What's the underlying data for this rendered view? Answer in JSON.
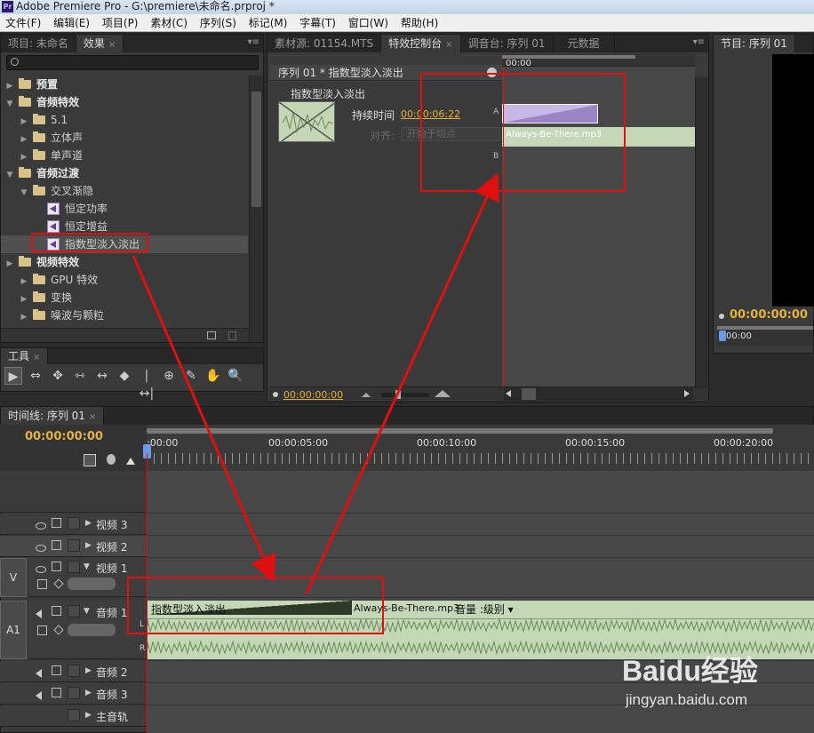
{
  "window": {
    "title": "Adobe Premiere Pro - G:\\premiere\\未命名.prproj *",
    "app_icon": "Pr"
  },
  "menu": [
    "文件(F)",
    "编辑(E)",
    "项目(P)",
    "素材(C)",
    "序列(S)",
    "标记(M)",
    "字幕(T)",
    "窗口(W)",
    "帮助(H)"
  ],
  "effects_panel": {
    "tabs": [
      "项目: 未命名",
      "效果"
    ],
    "close_glyph": "×",
    "menu_glyph": "▾≡",
    "tree": [
      {
        "label": "预置",
        "type": "folder",
        "bold": true,
        "expanded": false,
        "indent": 0
      },
      {
        "label": "音频特效",
        "type": "folder",
        "bold": true,
        "expanded": true,
        "indent": 0
      },
      {
        "label": "5.1",
        "type": "folder",
        "expanded": false,
        "indent": 1
      },
      {
        "label": "立体声",
        "type": "folder",
        "expanded": false,
        "indent": 1
      },
      {
        "label": "单声道",
        "type": "folder",
        "expanded": false,
        "indent": 1
      },
      {
        "label": "音频过渡",
        "type": "folder",
        "bold": true,
        "expanded": true,
        "indent": 0
      },
      {
        "label": "交叉渐隐",
        "type": "folder",
        "expanded": true,
        "indent": 1
      },
      {
        "label": "恒定功率",
        "type": "fx",
        "indent": 2
      },
      {
        "label": "恒定增益",
        "type": "fx",
        "indent": 2
      },
      {
        "label": "指数型淡入淡出",
        "type": "fx",
        "indent": 2,
        "selected": true
      },
      {
        "label": "视频特效",
        "type": "folder",
        "bold": true,
        "expanded": false,
        "indent": 0
      },
      {
        "label": "GPU 特效",
        "type": "folder",
        "expanded": false,
        "indent": 1
      },
      {
        "label": "变换",
        "type": "folder",
        "expanded": false,
        "indent": 1
      },
      {
        "label": "噪波与颗粒",
        "type": "folder",
        "expanded": false,
        "indent": 1
      }
    ]
  },
  "tools_panel": {
    "title": "工具",
    "tools": [
      "▶",
      "⇔",
      "✥",
      "⇿",
      "↔",
      "◆",
      "|↔|",
      "⊕",
      "✎",
      "✋",
      "🔍"
    ]
  },
  "effect_controls": {
    "tabs": [
      "素材源: 01154.MTS",
      "特效控制台",
      "调音台: 序列 01",
      "元数据"
    ],
    "header": "序列 01 * 指数型淡入淡出",
    "effect_name": "指数型淡入淡出",
    "duration_label": "持续时间",
    "duration_value": "00:00:06:22",
    "align_label": "对齐:",
    "align_value": "开始于切点",
    "timeline_start": "00:00",
    "track_a_label": "A",
    "track_b_label": "B",
    "clip_name": "Always-Be-There.mp3",
    "footer_time": "00:00:00:00"
  },
  "program_monitor": {
    "tab": "节目: 序列 01",
    "time": "00:00:00:00",
    "ruler_start": "00:00"
  },
  "timeline": {
    "tab": "时间线: 序列 01",
    "current_time": "00:00:00:00",
    "ruler_labels": [
      ":00:00",
      "00:00:05:00",
      "00:00:10:00",
      "00:00:15:00",
      "00:00:20:00"
    ],
    "section_v": "V",
    "section_a1": "A1",
    "tracks": {
      "video3": "视频 3",
      "video2": "视频 2",
      "video1": "视频 1",
      "audio1": "音频 1",
      "audio2": "音频 2",
      "audio3": "音频 3",
      "master": "主音轨"
    },
    "audio_clip": {
      "transition_label": "指数型淡入淡出",
      "clip_name": "Always-Be-There.mp3",
      "volume_label": "音量 :级别 ▾",
      "channel_l": "L",
      "channel_r": "R"
    }
  },
  "watermark": {
    "brand": "Baidu经验",
    "url": "jingyan.baidu.com"
  },
  "colors": {
    "accent_time": "#e3b23c",
    "annotation_red": "#e01010",
    "clip_green": "#c4d8b8",
    "transition_purple": "#b8a8d8"
  }
}
